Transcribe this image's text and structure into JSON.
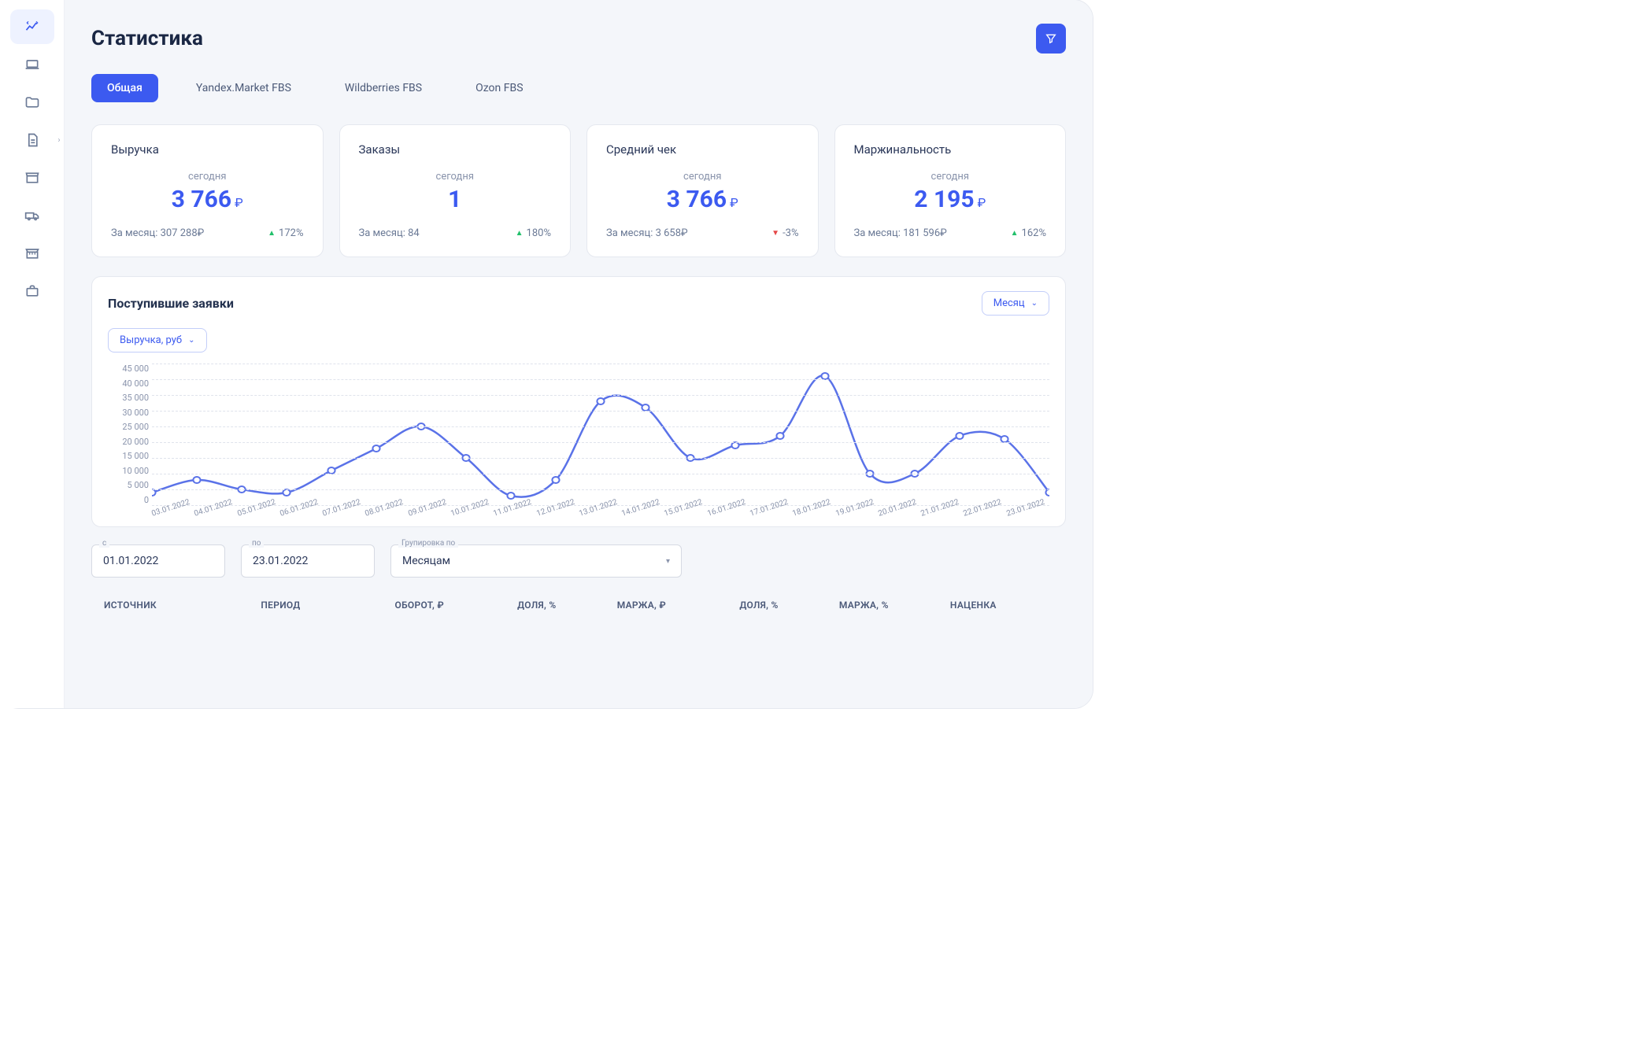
{
  "sidebar": [
    {
      "name": "stats-icon",
      "active": true
    },
    {
      "name": "pos-icon"
    },
    {
      "name": "folder-icon"
    },
    {
      "name": "document-icon",
      "expandable": true
    },
    {
      "name": "storefront-icon"
    },
    {
      "name": "truck-icon"
    },
    {
      "name": "market-icon"
    },
    {
      "name": "briefcase-icon"
    }
  ],
  "header": {
    "title": "Статистика"
  },
  "tabs": [
    {
      "label": "Общая",
      "active": true
    },
    {
      "label": "Yandex.Market FBS"
    },
    {
      "label": "Wildberries FBS"
    },
    {
      "label": "Ozon FBS"
    }
  ],
  "cards": [
    {
      "title": "Выручка",
      "sub": "сегодня",
      "value": "3 766",
      "cur": "₽",
      "month_label": "За месяц: 307 288₽",
      "delta": "172%",
      "dir": "up"
    },
    {
      "title": "Заказы",
      "sub": "сегодня",
      "value": "1",
      "cur": "",
      "month_label": "За месяц: 84",
      "delta": "180%",
      "dir": "up"
    },
    {
      "title": "Средний чек",
      "sub": "сегодня",
      "value": "3 766",
      "cur": "₽",
      "month_label": "За месяц: 3 658₽",
      "delta": "-3%",
      "dir": "down"
    },
    {
      "title": "Маржинальность",
      "sub": "сегодня",
      "value": "2 195",
      "cur": "₽",
      "month_label": "За месяц: 181 596₽",
      "delta": "162%",
      "dir": "up"
    }
  ],
  "chart": {
    "title": "Поступившие заявки",
    "period_label": "Месяц",
    "metric_label": "Выручка, руб"
  },
  "chart_data": {
    "type": "line",
    "ylabel": "",
    "xlabel": "",
    "ylim": [
      0,
      45000
    ],
    "y_ticks": [
      "45 000",
      "40 000",
      "35 000",
      "30 000",
      "25 000",
      "20 000",
      "15 000",
      "10 000",
      "5 000",
      "0"
    ],
    "categories": [
      "03.01.2022",
      "04.01.2022",
      "05.01.2022",
      "06.01.2022",
      "07.01.2022",
      "08.01.2022",
      "09.01.2022",
      "10.01.2022",
      "11.01.2022",
      "12.01.2022",
      "13.01.2022",
      "14.01.2022",
      "15.01.2022",
      "16.01.2022",
      "17.01.2022",
      "18.01.2022",
      "19.01.2022",
      "20.01.2022",
      "21.01.2022",
      "22.01.2022",
      "23.01.2022"
    ],
    "values": [
      4000,
      8000,
      5000,
      4000,
      11000,
      18000,
      25000,
      15000,
      3000,
      8000,
      33000,
      31000,
      15000,
      19000,
      22000,
      41000,
      10000,
      10000,
      22000,
      21000,
      4000
    ]
  },
  "filters": {
    "from_label": "с",
    "from": "01.01.2022",
    "to_label": "по",
    "to": "23.01.2022",
    "group_label": "Групировка по",
    "group": "Месяцам"
  },
  "table_columns": [
    "ИСТОЧНИК",
    "ПЕРИОД",
    "ОБОРОТ, ₽",
    "ДОЛЯ, %",
    "МАРЖА, ₽",
    "ДОЛЯ, %",
    "МАРЖА, %",
    "НАЦЕНКА"
  ]
}
